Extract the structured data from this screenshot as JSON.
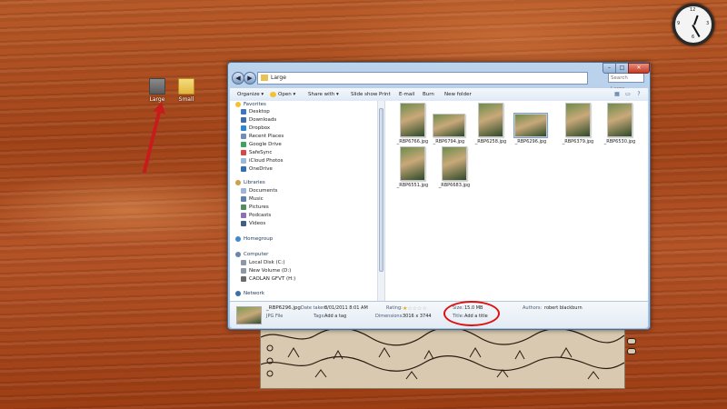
{
  "desktop": {
    "icons": [
      {
        "label": "Large",
        "kind": "photos"
      },
      {
        "label": "Small",
        "kind": "folder"
      }
    ]
  },
  "clock": {
    "numbers": [
      "12",
      "3",
      "6",
      "9"
    ]
  },
  "window": {
    "address": "Large",
    "search_placeholder": "Search Large",
    "controls": {
      "min": "–",
      "max": "□",
      "close": "✕"
    },
    "toolbar": [
      {
        "label": "Organize ▾"
      },
      {
        "label": "Open ▾",
        "icon": true
      },
      {
        "label": "Share with ▾"
      },
      {
        "label": "Slide show"
      },
      {
        "label": "Print"
      },
      {
        "label": "E-mail"
      },
      {
        "label": "Burn"
      },
      {
        "label": "New folder"
      }
    ],
    "nav": {
      "favorites": {
        "label": "Favorites",
        "items": [
          "Desktop",
          "Downloads",
          "Dropbox",
          "Recent Places",
          "Google Drive",
          "SafeSync",
          "iCloud Photos",
          "OneDrive"
        ]
      },
      "libraries": {
        "label": "Libraries",
        "items": [
          "Documents",
          "Music",
          "Pictures",
          "Podcasts",
          "Videos"
        ]
      },
      "homegroup": {
        "label": "Homegroup"
      },
      "computer": {
        "label": "Computer",
        "items": [
          "Local Disk (C:)",
          "New Volume (D:)",
          "CAOLAN GFVT (H:)"
        ]
      },
      "network": {
        "label": "Network"
      }
    },
    "files": [
      {
        "name": "_RBP6766.jpg"
      },
      {
        "name": "_RBP6794.jpg"
      },
      {
        "name": "_RBP6258.jpg"
      },
      {
        "name": "_RBP6296.jpg"
      },
      {
        "name": "_RBP6379.jpg"
      },
      {
        "name": "_RBP6530.jpg"
      },
      {
        "name": "_RBP6551.jpg"
      },
      {
        "name": "_RBP6683.jpg"
      }
    ],
    "details": {
      "file_name": "_RBP6296.jpg",
      "file_type": "JPG File",
      "date_taken_label": "Date taken:",
      "date_taken": "8/01/2011 8:01 AM",
      "tags_label": "Tags:",
      "tags": "Add a tag",
      "rating_label": "Rating:",
      "rating_value": 1,
      "dimensions_label": "Dimensions:",
      "dimensions": "3016 x 3744",
      "size_label": "Size:",
      "size": "15.0 MB",
      "title_label": "Title:",
      "title": "Add a title",
      "authors_label": "Authors:",
      "authors": "robert blackburn"
    }
  },
  "colors": {
    "annotation": "#d11111",
    "window_frame": "#a4c0e0",
    "desktop_wood": "#a8481c"
  }
}
